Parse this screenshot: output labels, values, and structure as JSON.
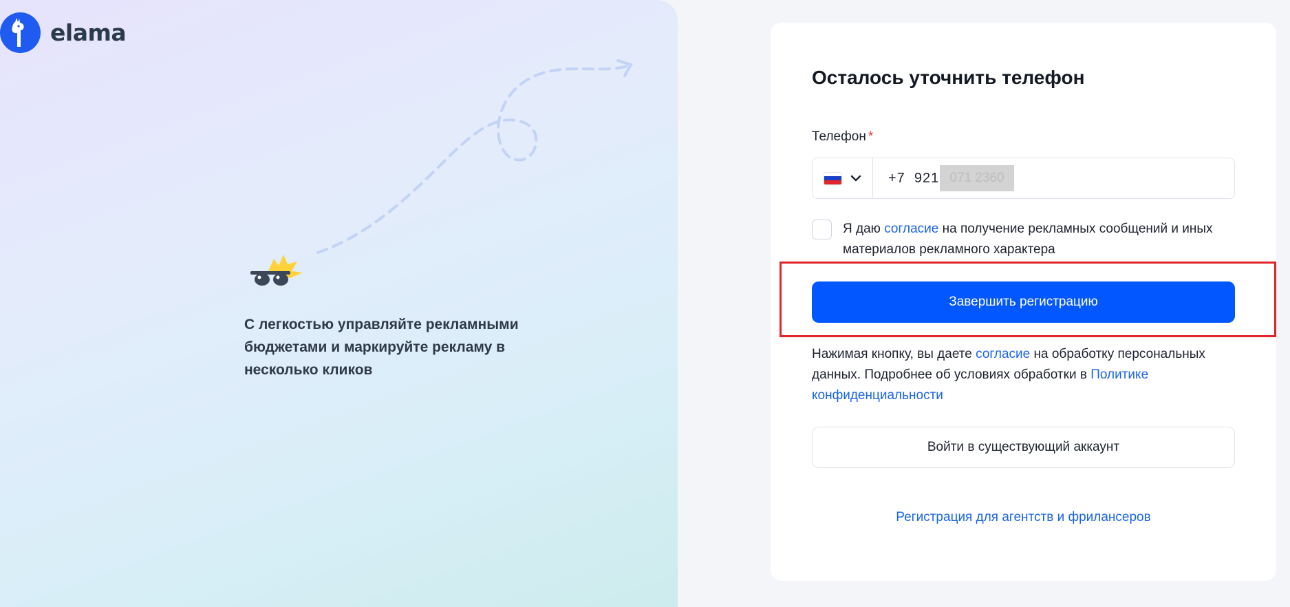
{
  "brand": {
    "name": "elama",
    "accent": "#1f5bf0"
  },
  "promo": {
    "text": "С легкостью управляйте рекламными бюджетами и маркируйте рекламу в несколько кликов"
  },
  "form": {
    "title": "Осталось уточнить телефон",
    "phone_label": "Телефон",
    "required_mark": "*",
    "country": {
      "flag": "ru-flag",
      "selected": "Russia"
    },
    "phone_value": "+7  921",
    "phone_redacted": "071 2360",
    "consent": {
      "prefix": "Я даю ",
      "link": "согласие",
      "suffix": " на получение рекламных сообщений и иных материалов рекламного характера",
      "checked": false
    },
    "submit_label": "Завершить регистрацию",
    "privacy": {
      "prefix": "Нажимая кнопку, вы даете ",
      "link1": "согласие",
      "middle": " на обработку персональных данных. Подробнее об условиях обработки в ",
      "link2": "Политике конфиденциальности"
    },
    "login_label": "Войти в существующий аккаунт",
    "agency_link": "Регистрация для агентств и фрилансеров"
  },
  "colors": {
    "primary_button": "#0357ff",
    "link": "#1a64e6",
    "highlight": "#e2242b",
    "required": "#e0352b"
  }
}
